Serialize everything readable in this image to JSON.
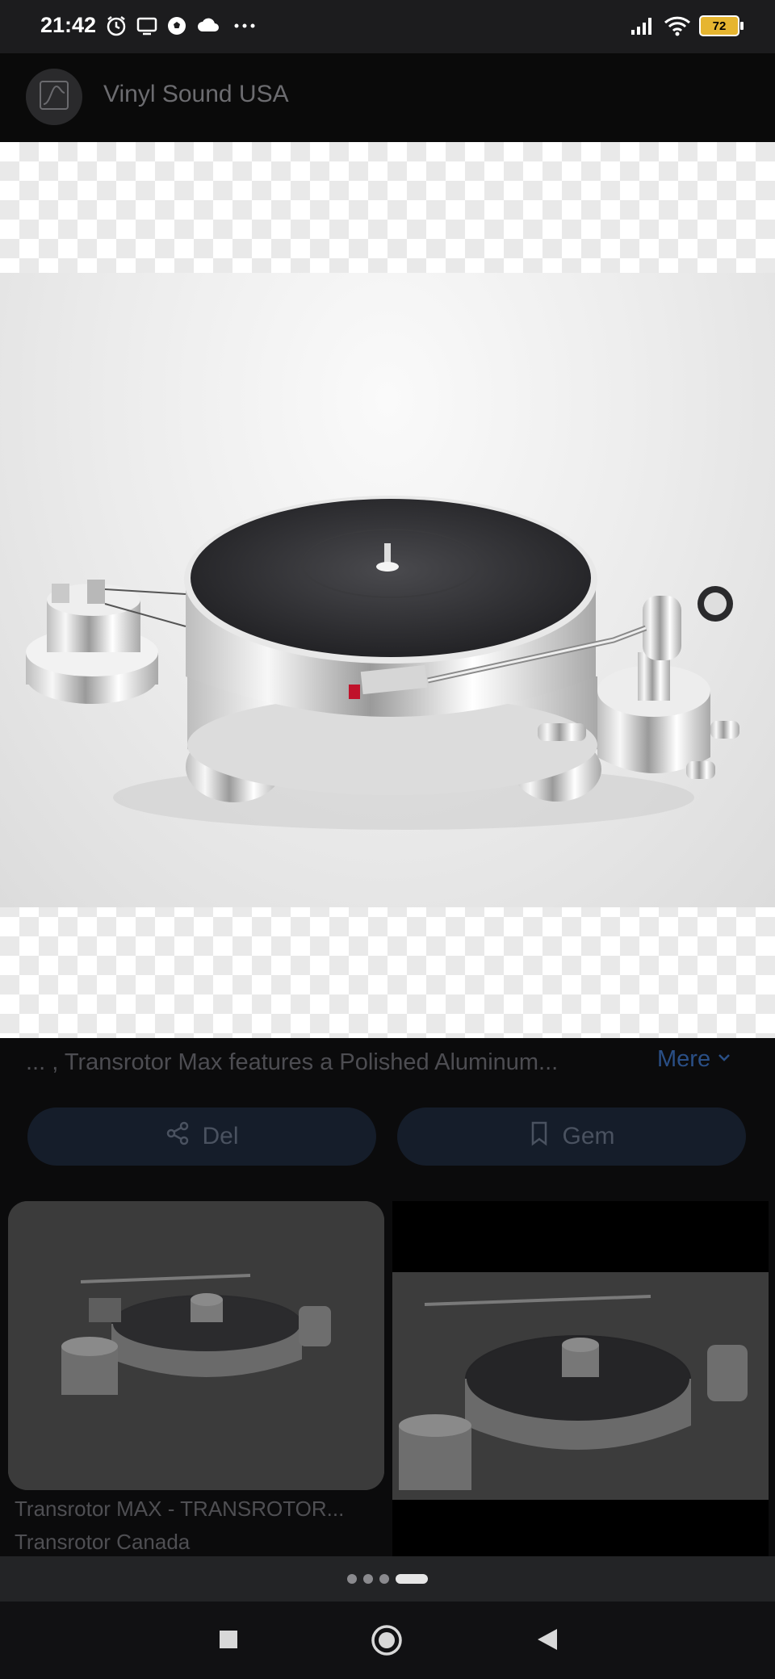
{
  "status_bar": {
    "time": "21:42",
    "battery": "72",
    "icons": [
      "alarm-icon",
      "tv-icon",
      "soccer-ball-icon",
      "cloud-icon",
      "more-dots-icon",
      "signal-icon",
      "wifi-icon",
      "battery-icon"
    ]
  },
  "header": {
    "site_name": "Vinyl Sound USA",
    "logo_icon": "waveform-logo-icon"
  },
  "image": {
    "caption": "... , Transrotor Max features a Polished Aluminum...",
    "more_label": "Mere"
  },
  "actions": {
    "share_label": "Del",
    "save_label": "Gem"
  },
  "related": [
    {
      "title": "Transrotor MAX - TRANSROTOR...",
      "source": "Transrotor Canada"
    },
    {
      "title": "",
      "source": ""
    }
  ],
  "pagination": {
    "count": 4,
    "active_index": 3
  },
  "nav": {
    "icons": [
      "recents-square-icon",
      "home-circle-icon",
      "back-triangle-icon"
    ]
  },
  "colors": {
    "link_blue": "#2a4f86",
    "pill_bg": "#151d2a",
    "accent_red": "#c0122a"
  }
}
